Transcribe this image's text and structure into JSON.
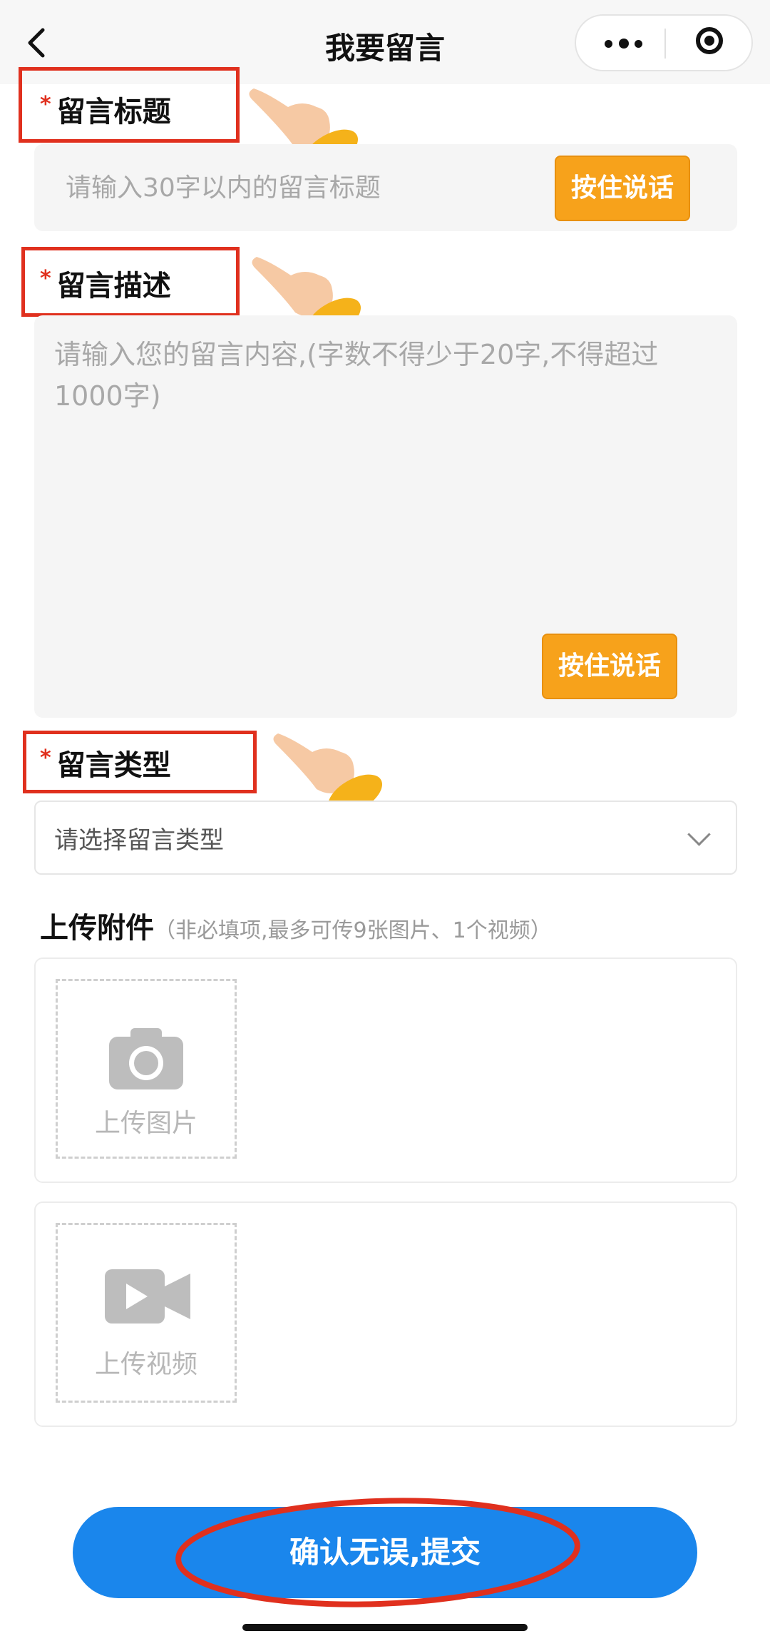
{
  "navbar": {
    "title": "我要留言"
  },
  "sections": {
    "title_label": "留言标题",
    "description_label": "留言描述",
    "type_label": "留言类型",
    "required_mark": "*"
  },
  "title_field": {
    "placeholder": "请输入30字以内的留言标题",
    "voice_label": "按住说话"
  },
  "description_field": {
    "placeholder": "请输入您的留言内容,(字数不得少于20字,不得超过1000字)",
    "voice_label": "按住说话"
  },
  "type_select": {
    "placeholder": "请选择留言类型"
  },
  "upload": {
    "heading": "上传附件",
    "note": "（非必填项,最多可传9张图片、1个视频）",
    "image_label": "上传图片",
    "video_label": "上传视频"
  },
  "submit": {
    "label": "确认无误,提交"
  },
  "colors": {
    "accent_orange": "#f7a21b",
    "primary_blue": "#1a86ec",
    "annotation_red": "#e0301e"
  },
  "annotations": {
    "pointer_icon": "pointing-hand-icon"
  }
}
